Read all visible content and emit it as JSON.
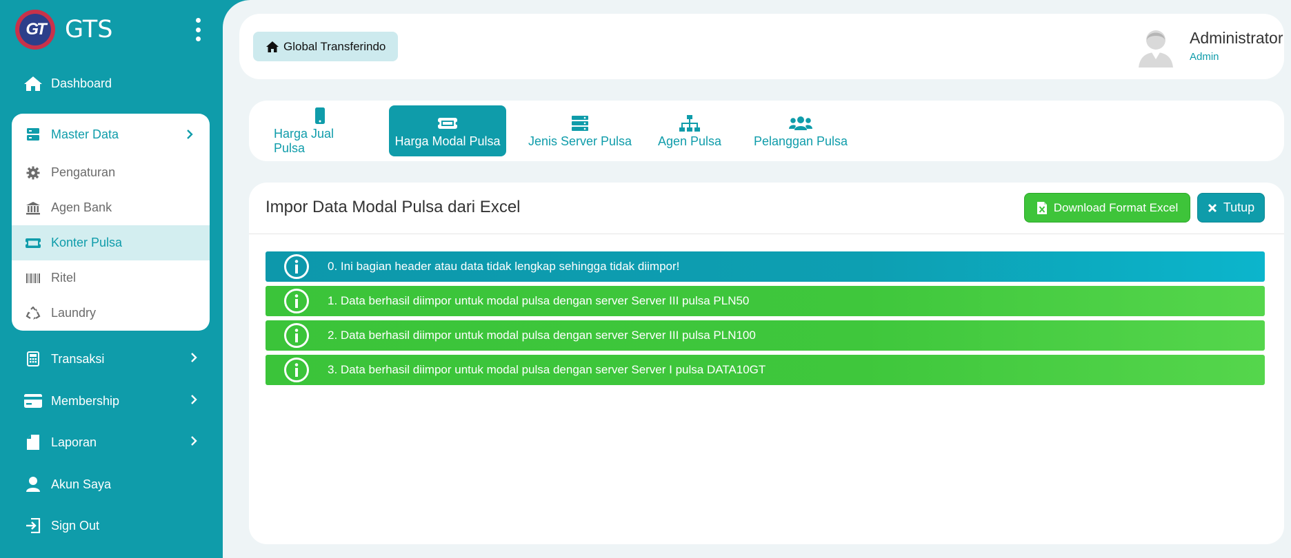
{
  "brand": {
    "name": "GTS",
    "logo_text": "GT"
  },
  "sidebar": {
    "dashboard": "Dashboard",
    "master_data": {
      "label": "Master Data",
      "items": [
        {
          "label": "Pengaturan",
          "icon": "gear-icon"
        },
        {
          "label": "Agen Bank",
          "icon": "bank-icon"
        },
        {
          "label": "Konter Pulsa",
          "icon": "ticket-icon",
          "active": true
        },
        {
          "label": "Ritel",
          "icon": "barcode-icon"
        },
        {
          "label": "Laundry",
          "icon": "recycle-icon"
        }
      ]
    },
    "transaksi": "Transaksi",
    "membership": "Membership",
    "laporan": "Laporan",
    "akun_saya": "Akun Saya",
    "sign_out": "Sign Out"
  },
  "header": {
    "home_label": "Global Transferindo",
    "user_name": "Administrator",
    "user_role": "Admin"
  },
  "tabs": [
    {
      "label": "Harga Jual Pulsa",
      "icon": "mobile-icon"
    },
    {
      "label": "Harga Modal Pulsa",
      "icon": "ticket-icon",
      "active": true
    },
    {
      "label": "Jenis Server Pulsa",
      "icon": "server-icon"
    },
    {
      "label": "Agen Pulsa",
      "icon": "sitemap-icon"
    },
    {
      "label": "Pelanggan Pulsa",
      "icon": "users-icon"
    }
  ],
  "card": {
    "title": "Impor Data Modal Pulsa dari Excel",
    "download_label": "Download Format Excel",
    "close_label": "Tutup",
    "alerts": [
      {
        "type": "info",
        "text": "0. Ini bagian header atau data tidak lengkap sehingga tidak diimpor!"
      },
      {
        "type": "ok",
        "text": "1. Data berhasil diimpor untuk modal pulsa dengan server Server III pulsa PLN50"
      },
      {
        "type": "ok",
        "text": "2. Data berhasil diimpor untuk modal pulsa dengan server Server III pulsa PLN100"
      },
      {
        "type": "ok",
        "text": "3. Data berhasil diimpor untuk modal pulsa dengan server Server I pulsa DATA10GT"
      }
    ]
  },
  "colors": {
    "primary": "#0f9caa",
    "success": "#3ec43a",
    "background": "#eef4f6"
  }
}
